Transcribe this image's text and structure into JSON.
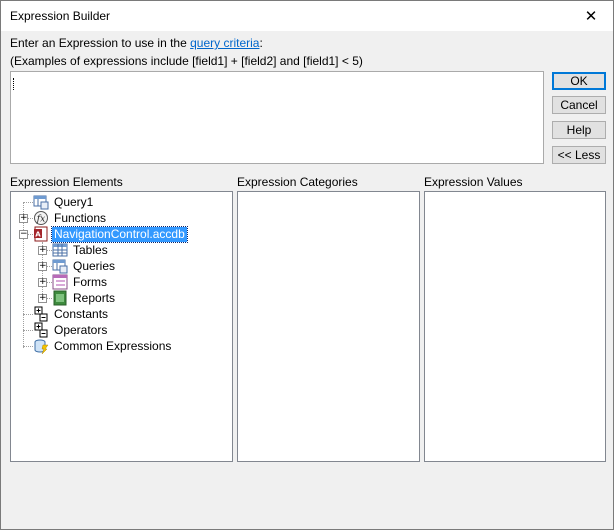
{
  "window": {
    "title": "Expression Builder",
    "close_glyph": "✕"
  },
  "intro": {
    "line1_prefix": "Enter an Expression to use in the ",
    "line1_link": "query criteria",
    "line1_suffix": ":",
    "line2": "(Examples of expressions include [field1] + [field2] and [field1] < 5)"
  },
  "expression": {
    "value": ""
  },
  "buttons": {
    "ok": "OK",
    "cancel": "Cancel",
    "help": "Help",
    "less": "<< Less"
  },
  "panes": {
    "elements_label": "Expression Elements",
    "categories_label": "Expression Categories",
    "values_label": "Expression Values"
  },
  "tree": {
    "query1": "Query1",
    "functions": "Functions",
    "database": "NavigationControl.accdb",
    "tables": "Tables",
    "queries": "Queries",
    "forms": "Forms",
    "reports": "Reports",
    "constants": "Constants",
    "operators": "Operators",
    "common_expressions": "Common Expressions"
  },
  "icons": {
    "query": "query-icon",
    "functions": "functions-icon",
    "database": "database-icon",
    "tables": "table-icon",
    "queries": "query-icon",
    "forms": "form-icon",
    "reports": "report-icon",
    "constants": "constants-icon",
    "operators": "operators-icon",
    "common": "common-expressions-icon"
  },
  "colors": {
    "selection": "#3399ff",
    "link": "#0066cc",
    "default_button_border": "#0078d7"
  }
}
